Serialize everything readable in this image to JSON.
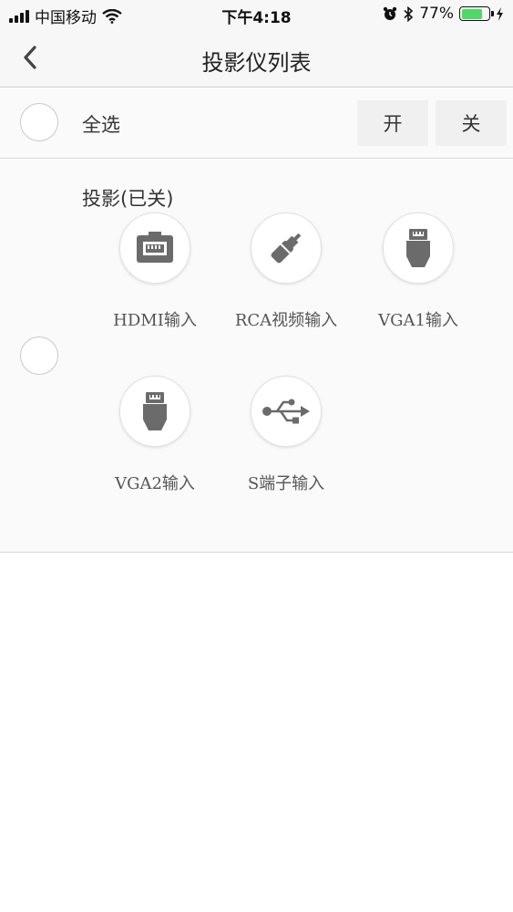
{
  "status_bar": {
    "carrier": "中国移动",
    "time": "下午4:18",
    "battery_percent": "77%",
    "battery_level": 0.77,
    "battery_color": "#4cd964",
    "icons": [
      "signal-icon",
      "wifi-icon",
      "alarm-icon",
      "bluetooth-icon",
      "battery-icon",
      "charging-icon"
    ]
  },
  "nav": {
    "title": "投影仪列表",
    "back_icon": "chevron-left-icon"
  },
  "select_all": {
    "label": "全选",
    "on_label": "开",
    "off_label": "关"
  },
  "device": {
    "name": "投影(已关)",
    "sources": [
      {
        "label": "HDMI输入",
        "icon": "hdmi-port-icon"
      },
      {
        "label": "RCA视频输入",
        "icon": "rca-plug-icon"
      },
      {
        "label": "VGA1输入",
        "icon": "vga-connector-icon"
      },
      {
        "label": "VGA2输入",
        "icon": "vga-connector-icon"
      },
      {
        "label": "S端子输入",
        "icon": "usb-icon"
      }
    ]
  },
  "colors": {
    "icon_gray": "#6b6b6b",
    "divider": "#d8d8d8"
  }
}
